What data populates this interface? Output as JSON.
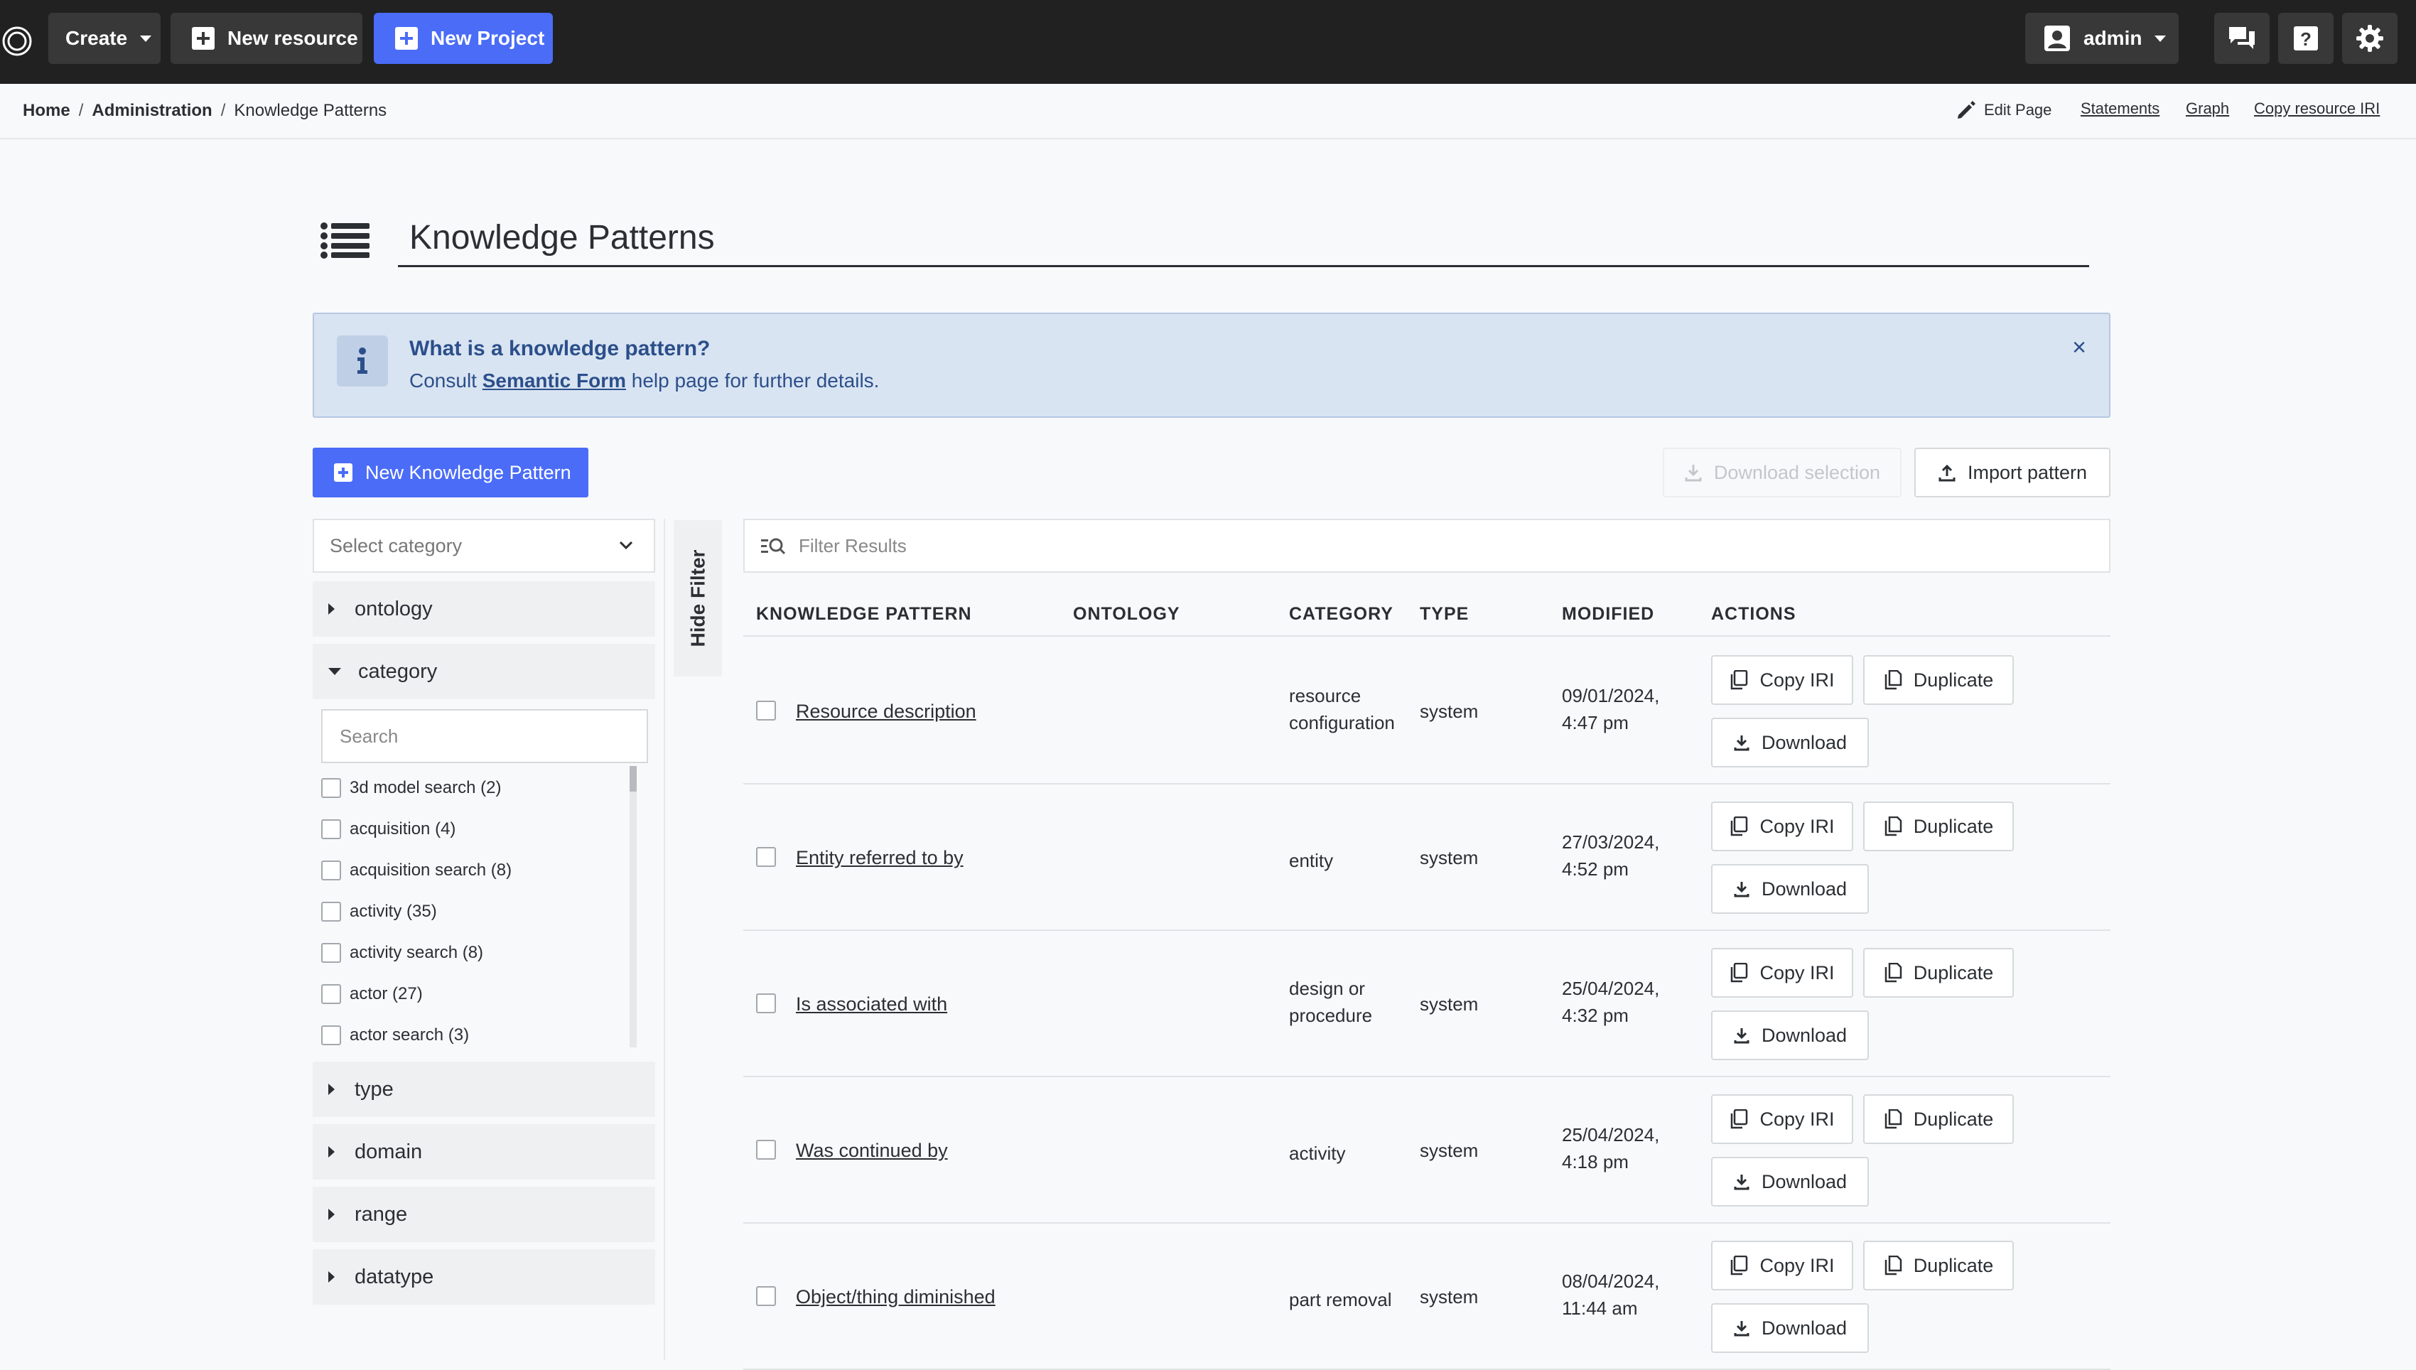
{
  "topbar": {
    "create_label": "Create",
    "new_resource_label": "New resource",
    "new_project_label": "New Project",
    "user_label": "admin"
  },
  "breadcrumb": {
    "home": "Home",
    "administration": "Administration",
    "current": "Knowledge Patterns",
    "separator": "/"
  },
  "page_links": {
    "edit_page": "Edit Page",
    "statements": "Statements",
    "graph": "Graph",
    "copy_iri": "Copy resource IRI"
  },
  "page": {
    "title": "Knowledge Patterns"
  },
  "info": {
    "title": "What is a knowledge pattern?",
    "text_before": "Consult ",
    "link": "Semantic Form",
    "text_after": " help page for further details.",
    "close": "×"
  },
  "toolbar": {
    "new_pattern": "New Knowledge Pattern",
    "download_selection": "Download selection",
    "import_pattern": "Import pattern"
  },
  "sidebar": {
    "select_placeholder": "Select category",
    "facets": [
      "ontology",
      "category",
      "type",
      "domain",
      "range",
      "datatype"
    ],
    "search_placeholder": "Search",
    "category_items": [
      "3d model search (2)",
      "acquisition (4)",
      "acquisition search (8)",
      "activity (35)",
      "activity search (8)",
      "actor (27)",
      "actor search (3)"
    ]
  },
  "hide_filter_label": "Hide Filter",
  "filter_placeholder": "Filter Results",
  "table": {
    "headers": [
      "KNOWLEDGE PATTERN",
      "ONTOLOGY",
      "CATEGORY",
      "TYPE",
      "MODIFIED",
      "ACTIONS"
    ],
    "action_labels": {
      "copy_iri": "Copy IRI",
      "duplicate": "Duplicate",
      "download": "Download"
    },
    "rows": [
      {
        "name": "Resource description",
        "ontology": "",
        "category": "resource configuration",
        "type": "system",
        "modified_date": "09/01/2024,",
        "modified_time": "4:47 pm"
      },
      {
        "name": "Entity referred to by",
        "ontology": "",
        "category": "entity",
        "type": "system",
        "modified_date": "27/03/2024,",
        "modified_time": "4:52 pm"
      },
      {
        "name": "Is associated with",
        "ontology": "",
        "category": "design or procedure",
        "type": "system",
        "modified_date": "25/04/2024,",
        "modified_time": "4:32 pm"
      },
      {
        "name": "Was continued by",
        "ontology": "",
        "category": "activity",
        "type": "system",
        "modified_date": "25/04/2024,",
        "modified_time": "4:18 pm"
      },
      {
        "name": "Object/thing diminished",
        "ontology": "",
        "category": "part removal",
        "type": "system",
        "modified_date": "08/04/2024,",
        "modified_time": "11:44 am"
      }
    ]
  },
  "colors": {
    "topbar_bg": "#212121",
    "primary": "#4a6cf7",
    "info_bg": "#d9e4f2",
    "info_text": "#2c4f8b"
  }
}
